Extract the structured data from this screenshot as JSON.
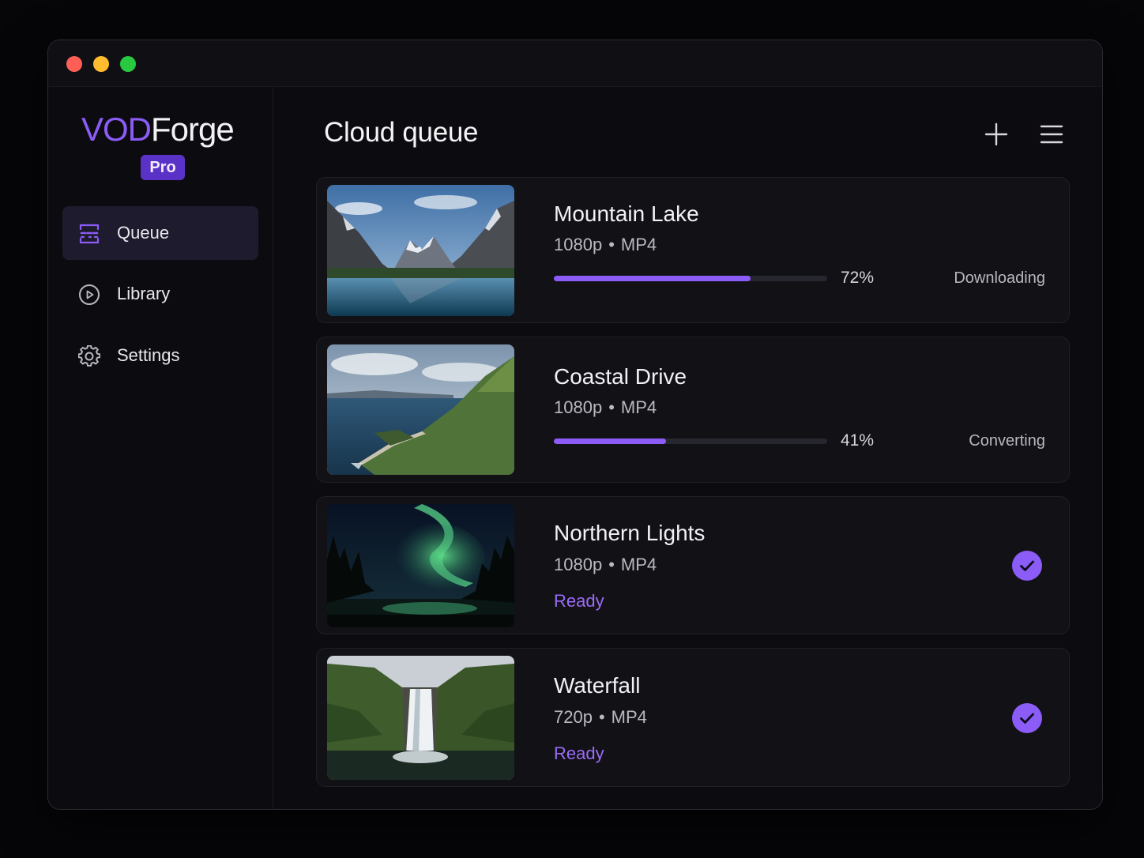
{
  "app": {
    "logo_part1": "VOD",
    "logo_part2": "Forge",
    "badge": "Pro"
  },
  "sidebar": {
    "items": [
      {
        "label": "Queue",
        "icon": "queue-icon",
        "active": true
      },
      {
        "label": "Library",
        "icon": "play-circle-icon",
        "active": false
      },
      {
        "label": "Settings",
        "icon": "gear-icon",
        "active": false
      }
    ]
  },
  "header": {
    "title": "Cloud queue",
    "add_icon": "plus-icon",
    "menu_icon": "hamburger-menu-icon"
  },
  "queue": [
    {
      "title": "Mountain Lake",
      "resolution": "1080p",
      "sep": "•",
      "format": "MP4",
      "progress": 72,
      "progress_label": "72%",
      "status": "Downloading",
      "thumbnail": "mountain-lake-thumbnail"
    },
    {
      "title": "Coastal Drive",
      "resolution": "1080p",
      "sep": "•",
      "format": "MP4",
      "progress": 41,
      "progress_label": "41%",
      "status": "Converting",
      "thumbnail": "coastal-drive-thumbnail"
    },
    {
      "title": "Northern Lights",
      "resolution": "1080p",
      "sep": "•",
      "format": "MP4",
      "status": "Ready",
      "thumbnail": "northern-lights-thumbnail",
      "done_icon": "check-circle-icon"
    },
    {
      "title": "Waterfall",
      "resolution": "720p",
      "sep": "•",
      "format": "MP4",
      "status": "Ready",
      "thumbnail": "waterfall-thumbnail",
      "done_icon": "check-circle-icon"
    }
  ],
  "colors": {
    "accent": "#8b5cf6",
    "background": "#0c0c10",
    "card": "#111116",
    "ready_text": "#9b6cf7"
  }
}
